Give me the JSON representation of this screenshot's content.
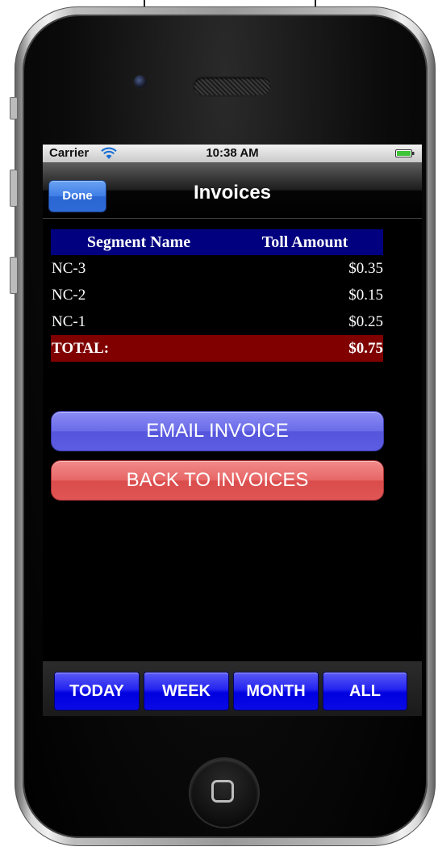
{
  "status_bar": {
    "carrier": "Carrier",
    "time": "10:38 AM",
    "wifi_icon": "wifi-icon",
    "battery_icon": "battery-icon"
  },
  "nav_bar": {
    "done_label": "Done",
    "title": "Invoices"
  },
  "table": {
    "headers": [
      "Segment Name",
      "Toll Amount"
    ],
    "rows": [
      {
        "segment": "NC-3",
        "amount": "$0.35"
      },
      {
        "segment": "NC-2",
        "amount": "$0.15"
      },
      {
        "segment": "NC-1",
        "amount": "$0.25"
      }
    ],
    "total": {
      "label": "TOTAL:",
      "amount": "$0.75"
    }
  },
  "buttons": {
    "email": "EMAIL INVOICE",
    "back": "BACK TO INVOICES"
  },
  "tabs": [
    {
      "label": "TODAY"
    },
    {
      "label": "WEEK"
    },
    {
      "label": "MONTH"
    },
    {
      "label": "ALL"
    }
  ],
  "colors": {
    "table_header_bg": "#01007f",
    "total_row_bg": "#800000",
    "email_button": "#6a6be8",
    "back_button": "#e76666",
    "tab_button": "#0000e0",
    "done_button": "#3f7ee6"
  }
}
